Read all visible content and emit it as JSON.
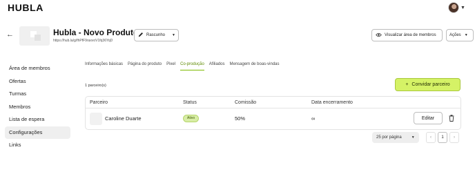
{
  "app": {
    "logo": "HUBLA"
  },
  "header": {
    "back_icon": "arrow-left-icon",
    "product_title": "Hubla - Novo Produto",
    "product_url": "https://hub.la/g/fhPfF9raxvoV1fq36YqD",
    "status_label": "Rascunho",
    "view_members_label": "Visualizar área de membros",
    "actions_label": "Ações"
  },
  "sidebar": {
    "items": [
      {
        "label": "Área de membros"
      },
      {
        "label": "Ofertas"
      },
      {
        "label": "Turmas"
      },
      {
        "label": "Membros"
      },
      {
        "label": "Lista de espera"
      },
      {
        "label": "Configurações",
        "active": true
      },
      {
        "label": "Links"
      }
    ]
  },
  "tabs": [
    {
      "label": "Informações básicas"
    },
    {
      "label": "Página do produto"
    },
    {
      "label": "Pixel"
    },
    {
      "label": "Co-produção",
      "active": true
    },
    {
      "label": "Afiliados"
    },
    {
      "label": "Mensagem de boas-vindas"
    }
  ],
  "partners": {
    "count_label": "1 parceiro(s)",
    "invite_label": "Convidar parceiro",
    "columns": [
      "Parceiro",
      "Status",
      "Comissão",
      "Data encerramento"
    ],
    "rows": [
      {
        "name": "Caroline Duarte",
        "status": "Ativo",
        "commission": "50%",
        "end_date": "∞",
        "edit_label": "Editar"
      }
    ]
  },
  "pagination": {
    "per_page_label": "25 por página",
    "prev": "‹",
    "current_page": "1",
    "next": "›"
  },
  "colors": {
    "accent": "#d5f266",
    "active_tab": "#5d8a00",
    "status_badge": "#d8eda6"
  }
}
